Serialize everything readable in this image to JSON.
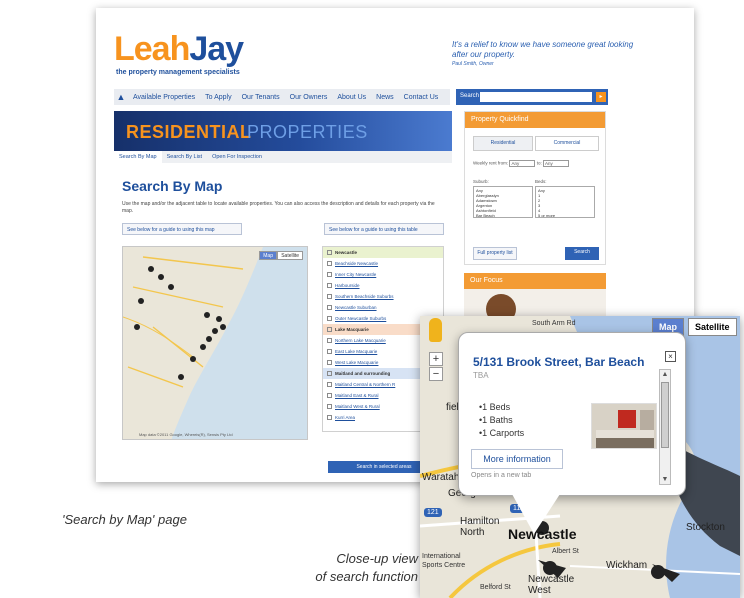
{
  "site": {
    "logo_part1": "Leah",
    "logo_part2": "Jay",
    "tagline": "the property management specialists",
    "quote": "It's a relief to know we have someone great looking after our property.",
    "quote_by": "Paul Smith, Owner",
    "nav": [
      "Available Properties",
      "To Apply",
      "Our Tenants",
      "Our Owners",
      "About Us",
      "News",
      "Contact Us"
    ],
    "search_label": "Search",
    "banner_bold": "RESIDENTIAL",
    "banner_light": "PROPERTIES",
    "subtabs": [
      "Search By Map",
      "Search By List",
      "Open For Inspection"
    ],
    "heading": "Search By Map",
    "intro": "Use the map and/or the adjacent table to locate available properties. You can also access the description and details for each property via the map.",
    "guide_map": "See below for a guide to using this map",
    "guide_table": "See below for a guide to using this table",
    "map_btn": "Map",
    "sat_btn": "Satellite",
    "map_credit": "Map data ©2011 Google, Whereis(R), Sensis Pty Ltd",
    "areas": [
      {
        "label": "Newcastle",
        "type": "hdr",
        "color": "g"
      },
      {
        "label": "Beachside Newcastle",
        "type": "item"
      },
      {
        "label": "Inner City Newcastle",
        "type": "item"
      },
      {
        "label": "Harbourside",
        "type": "item"
      },
      {
        "label": "Southern Beachside Suburbs",
        "type": "item"
      },
      {
        "label": "Newcastle Suburban",
        "type": "item"
      },
      {
        "label": "Outer Newcastle Suburbs",
        "type": "item"
      },
      {
        "label": "Lake Macquarie",
        "type": "hdr",
        "color": "o"
      },
      {
        "label": "Northern Lake Macquarie",
        "type": "item"
      },
      {
        "label": "East Lake Macquarie",
        "type": "item"
      },
      {
        "label": "West Lake Macquarie",
        "type": "item"
      },
      {
        "label": "Maitland and surrounding",
        "type": "hdr",
        "color": "b"
      },
      {
        "label": "Maitland Central & Northern R",
        "type": "item"
      },
      {
        "label": "Maitland East & Rural",
        "type": "item"
      },
      {
        "label": "Maitland West & Rural",
        "type": "item"
      },
      {
        "label": "Kurri Area",
        "type": "item"
      }
    ],
    "search_selected": "Search in selected areas",
    "quickfind": {
      "title": "Property Quickfind",
      "tab_residential": "Residential",
      "tab_commercial": "Commercial",
      "rent_label": "Weekly rent from:",
      "rent_from": "Any",
      "rent_to_label": "to:",
      "rent_to": "Any",
      "suburb_label": "Suburb:",
      "beds_label": "Beds:",
      "suburbs": [
        "Any",
        "Aberglasslyn",
        "Adamstown",
        "Argenton",
        "Ashtonfield",
        "Bar Beach"
      ],
      "beds": [
        "Any",
        "1",
        "2",
        "3",
        "4",
        "5 or more"
      ],
      "full_list": "Full property list",
      "search": "Search"
    },
    "focus_title": "Our Focus"
  },
  "closeup": {
    "map_btn": "Map",
    "sat_btn": "Satellite",
    "popup": {
      "title": "5/131 Brook Street, Bar Beach",
      "subtitle": "TBA",
      "features": [
        "1 Beds",
        "1 Baths",
        "1 Carports"
      ],
      "more": "More information",
      "new_tab": "Opens in a new tab"
    },
    "labels": {
      "newcastle": "Newcastle",
      "stockton": "Stockton",
      "hamilton_north": "Hamilton North",
      "wickham": "Wickham",
      "newcastle_west": "Newcastle West",
      "georgetown": "Georgeto",
      "waratah": "Waratah",
      "field_west": "field West",
      "international": "International Sports Centre",
      "south_arm": "South Arm Rd",
      "albert_st": "Albert St",
      "belford_st": "Belford St",
      "shield_121": "121",
      "shield_111": "111"
    }
  },
  "captions": {
    "search_by_map": "'Search by Map' page",
    "closeup_line1": "Close-up view",
    "closeup_line2": "of search function"
  }
}
